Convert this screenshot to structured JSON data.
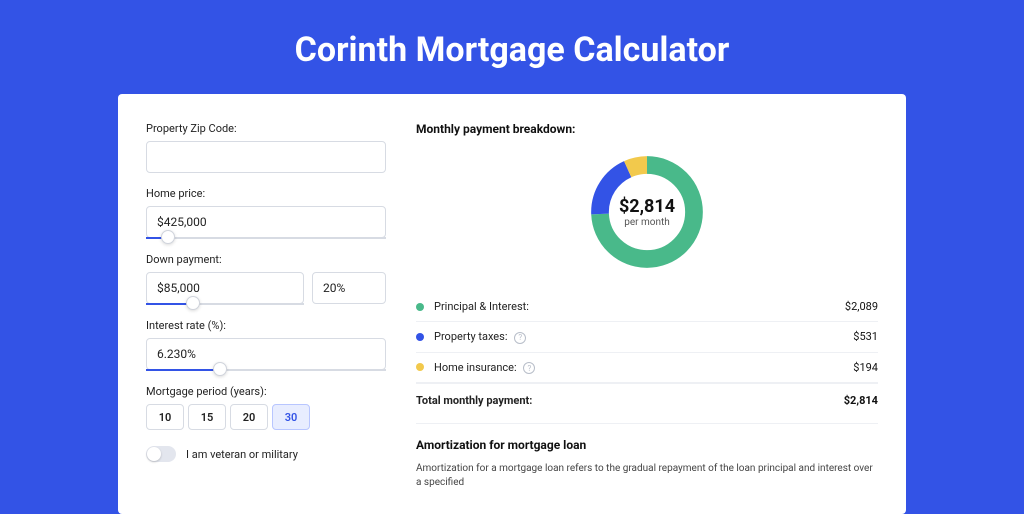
{
  "title": "Corinth Mortgage Calculator",
  "form": {
    "zip": {
      "label": "Property Zip Code:",
      "value": ""
    },
    "home_price": {
      "label": "Home price:",
      "value": "$425,000",
      "slider_pct": 9
    },
    "down_payment": {
      "label": "Down payment:",
      "amount": "$85,000",
      "percent": "20%",
      "slider_pct": 20
    },
    "interest": {
      "label": "Interest rate (%):",
      "value": "6.230%",
      "slider_pct": 31
    },
    "period": {
      "label": "Mortgage period (years):",
      "options": [
        "10",
        "15",
        "20",
        "30"
      ],
      "selected": "30"
    },
    "veteran": {
      "label": "I am veteran or military",
      "checked": false
    }
  },
  "breakdown": {
    "title": "Monthly payment breakdown:",
    "center_amount": "$2,814",
    "center_sub": "per month",
    "items": [
      {
        "label": "Principal & Interest:",
        "value": "$2,089",
        "color": "#49b98a",
        "info": false
      },
      {
        "label": "Property taxes:",
        "value": "$531",
        "color": "#3353e6",
        "info": true
      },
      {
        "label": "Home insurance:",
        "value": "$194",
        "color": "#f2c94c",
        "info": true
      }
    ],
    "total": {
      "label": "Total monthly payment:",
      "value": "$2,814"
    }
  },
  "amort": {
    "title": "Amortization for mortgage loan",
    "text": "Amortization for a mortgage loan refers to the gradual repayment of the loan principal and interest over a specified"
  },
  "chart_data": {
    "type": "pie",
    "title": "Monthly payment breakdown",
    "series": [
      {
        "name": "Principal & Interest",
        "value": 2089,
        "color": "#49b98a"
      },
      {
        "name": "Property taxes",
        "value": 531,
        "color": "#3353e6"
      },
      {
        "name": "Home insurance",
        "value": 194,
        "color": "#f2c94c"
      }
    ],
    "total": 2814,
    "center_label": "$2,814 per month"
  }
}
